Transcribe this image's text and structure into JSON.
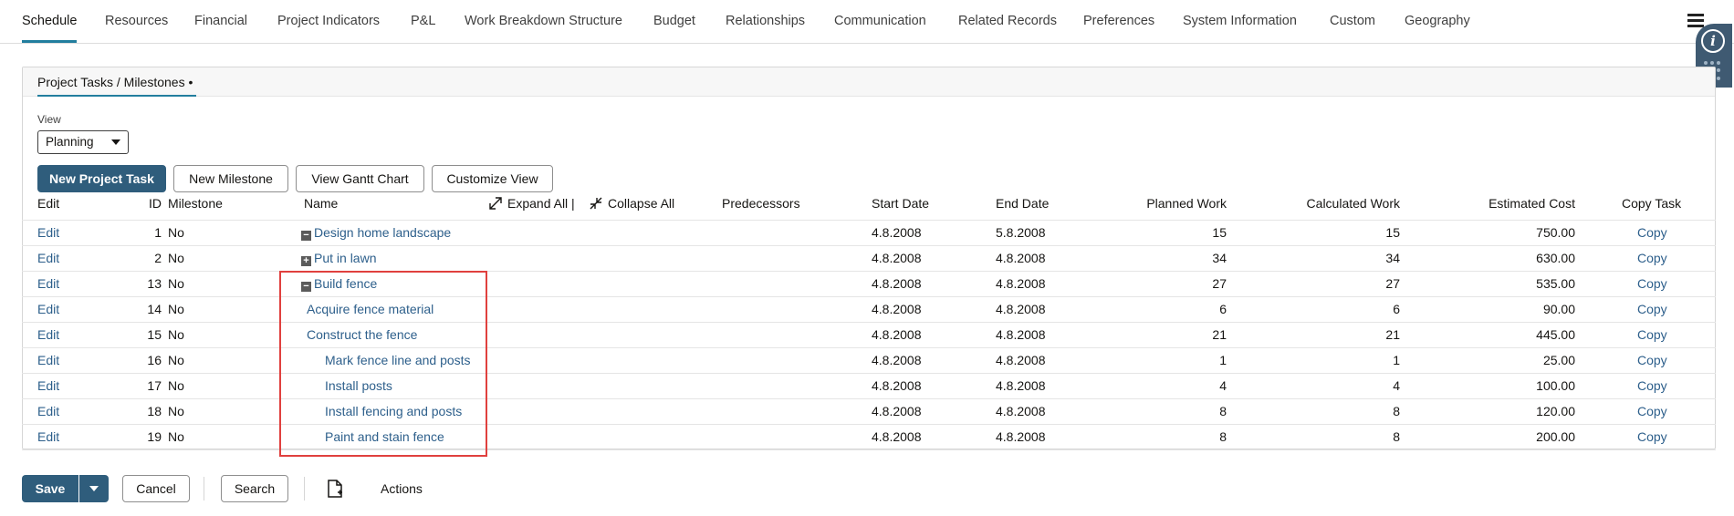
{
  "top_tabs": [
    {
      "label": "Schedule",
      "active": true
    },
    {
      "label": "Resources"
    },
    {
      "label": "Financial"
    },
    {
      "label": "Project Indicators"
    },
    {
      "label": "P&L"
    },
    {
      "label": "Work Breakdown Structure"
    },
    {
      "label": "Budget"
    },
    {
      "label": "Relationships"
    },
    {
      "label": "Communication"
    },
    {
      "label": "Related Records"
    },
    {
      "label": "Preferences"
    },
    {
      "label": "System Information"
    },
    {
      "label": "Custom"
    },
    {
      "label": "Geography"
    }
  ],
  "help_widget": {
    "icon": "info-icon",
    "label": "i"
  },
  "subtab": {
    "label": "Project Tasks / Milestones •"
  },
  "view": {
    "label": "View",
    "selected": "Planning"
  },
  "toolbar": {
    "new_task": "New Project Task",
    "new_milestone": "New Milestone",
    "gantt": "View Gantt Chart",
    "customize": "Customize View"
  },
  "table": {
    "headers": {
      "edit": "Edit",
      "id": "ID",
      "milestone": "Milestone",
      "name": "Name",
      "expand_all": "Expand All |",
      "collapse_all": "Collapse All",
      "predecessors": "Predecessors",
      "start": "Start Date",
      "end": "End Date",
      "planned": "Planned Work",
      "calculated": "Calculated Work",
      "cost": "Estimated Cost",
      "copy": "Copy Task"
    },
    "rows": [
      {
        "edit": "Edit",
        "id": "1",
        "milestone": "No",
        "name": "Design home landscape",
        "toggle": "−",
        "level": 0,
        "start": "4.8.2008",
        "end": "5.8.2008",
        "planned": "15",
        "calculated": "15",
        "cost": "750.00",
        "copy": "Copy"
      },
      {
        "edit": "Edit",
        "id": "2",
        "milestone": "No",
        "name": "Put in lawn",
        "toggle": "+",
        "level": 0,
        "start": "4.8.2008",
        "end": "4.8.2008",
        "planned": "34",
        "calculated": "34",
        "cost": "630.00",
        "copy": "Copy"
      },
      {
        "edit": "Edit",
        "id": "13",
        "milestone": "No",
        "name": "Build fence",
        "toggle": "−",
        "level": 0,
        "start": "4.8.2008",
        "end": "4.8.2008",
        "planned": "27",
        "calculated": "27",
        "cost": "535.00",
        "copy": "Copy"
      },
      {
        "edit": "Edit",
        "id": "14",
        "milestone": "No",
        "name": "Acquire fence material",
        "toggle": "",
        "level": 1,
        "start": "4.8.2008",
        "end": "4.8.2008",
        "planned": "6",
        "calculated": "6",
        "cost": "90.00",
        "copy": "Copy"
      },
      {
        "edit": "Edit",
        "id": "15",
        "milestone": "No",
        "name": "Construct the fence",
        "toggle": "",
        "level": 1,
        "start": "4.8.2008",
        "end": "4.8.2008",
        "planned": "21",
        "calculated": "21",
        "cost": "445.00",
        "copy": "Copy"
      },
      {
        "edit": "Edit",
        "id": "16",
        "milestone": "No",
        "name": "Mark fence line and posts",
        "toggle": "",
        "level": 2,
        "start": "4.8.2008",
        "end": "4.8.2008",
        "planned": "1",
        "calculated": "1",
        "cost": "25.00",
        "copy": "Copy"
      },
      {
        "edit": "Edit",
        "id": "17",
        "milestone": "No",
        "name": "Install posts",
        "toggle": "",
        "level": 2,
        "start": "4.8.2008",
        "end": "4.8.2008",
        "planned": "4",
        "calculated": "4",
        "cost": "100.00",
        "copy": "Copy"
      },
      {
        "edit": "Edit",
        "id": "18",
        "milestone": "No",
        "name": "Install fencing and posts",
        "toggle": "",
        "level": 2,
        "start": "4.8.2008",
        "end": "4.8.2008",
        "planned": "8",
        "calculated": "8",
        "cost": "120.00",
        "copy": "Copy"
      },
      {
        "edit": "Edit",
        "id": "19",
        "milestone": "No",
        "name": "Paint and stain fence",
        "toggle": "",
        "level": 2,
        "start": "4.8.2008",
        "end": "4.8.2008",
        "planned": "8",
        "calculated": "8",
        "cost": "200.00",
        "copy": "Copy"
      }
    ]
  },
  "footer": {
    "save": "Save",
    "cancel": "Cancel",
    "search": "Search",
    "actions": "Actions"
  },
  "colors": {
    "accent": "#227e9e",
    "primary_button": "#2f5d7c",
    "link": "#2d5f8b",
    "highlight": "#e0403e"
  }
}
